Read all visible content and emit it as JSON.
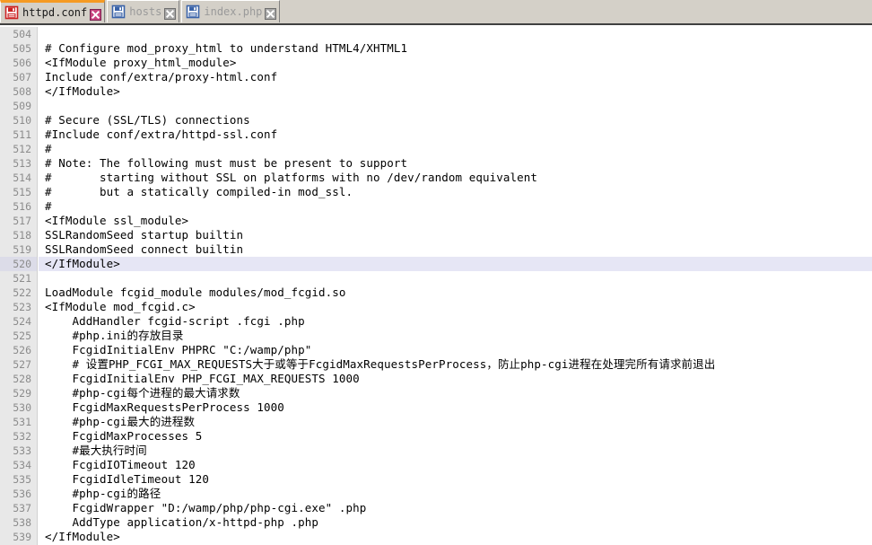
{
  "window": {
    "accent_active_tab": "#f59a23",
    "tabbar_background": "#d4d0c8",
    "editor_background": "#ffffff",
    "gutter_background": "#e8e8e8",
    "highlight_line_color": "#e6e6f5",
    "line_number_color": "#8c8c8c"
  },
  "tabs": [
    {
      "label": "httpd.conf",
      "icon": "floppy-disk-icon",
      "icon_color": "#cc2222",
      "active": true,
      "close_label": "✕",
      "close_style": "magenta"
    },
    {
      "label": "hosts",
      "icon": "floppy-disk-icon",
      "icon_color": "#3a63a8",
      "active": false,
      "close_label": "✕",
      "close_style": "gray"
    },
    {
      "label": "index.php",
      "icon": "floppy-disk-icon",
      "icon_color": "#3a63a8",
      "active": false,
      "close_label": "✕",
      "close_style": "gray"
    }
  ],
  "editor": {
    "first_line_number": 504,
    "highlighted_line_number": 520,
    "lines": [
      {
        "n": 504,
        "text": ""
      },
      {
        "n": 505,
        "text": "# Configure mod_proxy_html to understand HTML4/XHTML1"
      },
      {
        "n": 506,
        "text": "<IfModule proxy_html_module>"
      },
      {
        "n": 507,
        "text": "Include conf/extra/proxy-html.conf"
      },
      {
        "n": 508,
        "text": "</IfModule>"
      },
      {
        "n": 509,
        "text": ""
      },
      {
        "n": 510,
        "text": "# Secure (SSL/TLS) connections"
      },
      {
        "n": 511,
        "text": "#Include conf/extra/httpd-ssl.conf"
      },
      {
        "n": 512,
        "text": "#"
      },
      {
        "n": 513,
        "text": "# Note: The following must must be present to support"
      },
      {
        "n": 514,
        "text": "#       starting without SSL on platforms with no /dev/random equivalent"
      },
      {
        "n": 515,
        "text": "#       but a statically compiled-in mod_ssl."
      },
      {
        "n": 516,
        "text": "#"
      },
      {
        "n": 517,
        "text": "<IfModule ssl_module>"
      },
      {
        "n": 518,
        "text": "SSLRandomSeed startup builtin"
      },
      {
        "n": 519,
        "text": "SSLRandomSeed connect builtin"
      },
      {
        "n": 520,
        "text": "</IfModule>"
      },
      {
        "n": 521,
        "text": ""
      },
      {
        "n": 522,
        "text": "LoadModule fcgid_module modules/mod_fcgid.so"
      },
      {
        "n": 523,
        "text": "<IfModule mod_fcgid.c>"
      },
      {
        "n": 524,
        "text": "    AddHandler fcgid-script .fcgi .php"
      },
      {
        "n": 525,
        "text": "    #php.ini的存放目录"
      },
      {
        "n": 526,
        "text": "    FcgidInitialEnv PHPRC \"C:/wamp/php\""
      },
      {
        "n": 527,
        "text": "    # 设置PHP_FCGI_MAX_REQUESTS大于或等于FcgidMaxRequestsPerProcess，防止php-cgi进程在处理完所有请求前退出"
      },
      {
        "n": 528,
        "text": "    FcgidInitialEnv PHP_FCGI_MAX_REQUESTS 1000"
      },
      {
        "n": 529,
        "text": "    #php-cgi每个进程的最大请求数"
      },
      {
        "n": 530,
        "text": "    FcgidMaxRequestsPerProcess 1000"
      },
      {
        "n": 531,
        "text": "    #php-cgi最大的进程数"
      },
      {
        "n": 532,
        "text": "    FcgidMaxProcesses 5"
      },
      {
        "n": 533,
        "text": "    #最大执行时间"
      },
      {
        "n": 534,
        "text": "    FcgidIOTimeout 120"
      },
      {
        "n": 535,
        "text": "    FcgidIdleTimeout 120"
      },
      {
        "n": 536,
        "text": "    #php-cgi的路径"
      },
      {
        "n": 537,
        "text": "    FcgidWrapper \"D:/wamp/php/php-cgi.exe\" .php"
      },
      {
        "n": 538,
        "text": "    AddType application/x-httpd-php .php"
      },
      {
        "n": 539,
        "text": "</IfModule>"
      }
    ]
  }
}
